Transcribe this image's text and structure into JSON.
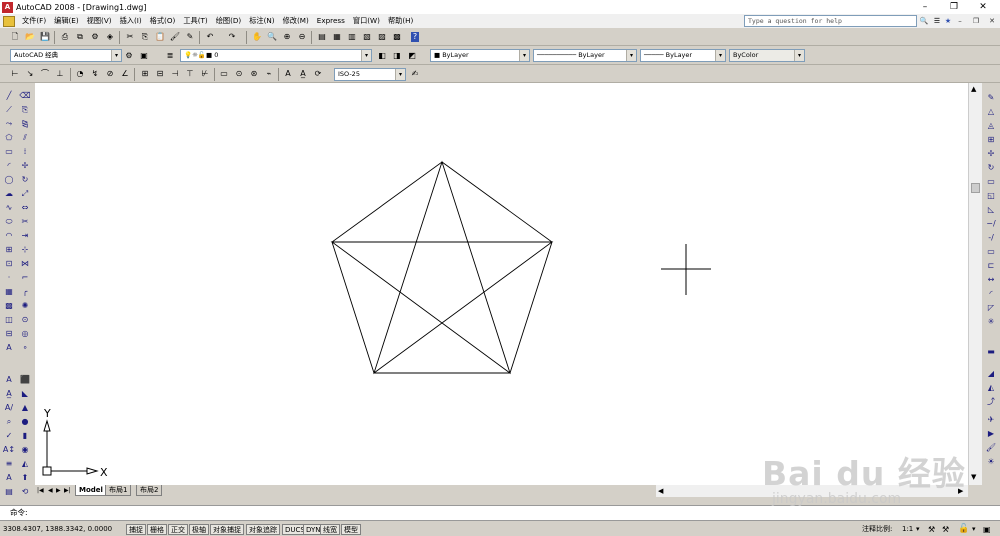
{
  "window": {
    "title": "AutoCAD 2008 - [Drawing1.dwg]",
    "app_icon": "autocad-logo-icon",
    "minimize": "–",
    "restore": "❐",
    "close": "✕",
    "mdi_minimize": "–",
    "mdi_restore": "❐",
    "mdi_close": "✕"
  },
  "menubar": {
    "items": [
      "文件(F)",
      "编辑(E)",
      "视图(V)",
      "插入(I)",
      "格式(O)",
      "工具(T)",
      "绘图(D)",
      "标注(N)",
      "修改(M)",
      "Express",
      "窗口(W)",
      "帮助(H)"
    ]
  },
  "help": {
    "placeholder": "Type a question for help"
  },
  "toolbars": {
    "workspace": "AutoCAD 经典",
    "layer": "0",
    "color": "ByLayer",
    "linetype": "ByLayer",
    "lineweight": "ByLayer",
    "plotstyle": "ByColor",
    "dimstyle": "ISO-25"
  },
  "ucs": {
    "y_label": "Y",
    "x_label": "X"
  },
  "tabs": {
    "nav_first": "|◀",
    "nav_prev": "◀",
    "nav_next": "▶",
    "nav_last": "▶|",
    "items": [
      "Model",
      "布局1",
      "布局2"
    ]
  },
  "command": {
    "prompt": "命令:"
  },
  "statusbar": {
    "coords": "3308.4307, 1388.3342, 0.0000",
    "toggles": [
      "捕捉",
      "栅格",
      "正交",
      "极轴",
      "对象捕捉",
      "对象追踪",
      "DUCS",
      "DYN",
      "线宽",
      "模型"
    ],
    "annotation_scale_label": "注释比例:",
    "annotation_scale_value": "1:1"
  },
  "watermark": {
    "brand": "Bai du 经验",
    "url": "jingyan.baidu.com"
  },
  "colors": {
    "canvas": "#ffffff",
    "chrome": "#d4d0c8",
    "line": "#000000"
  }
}
